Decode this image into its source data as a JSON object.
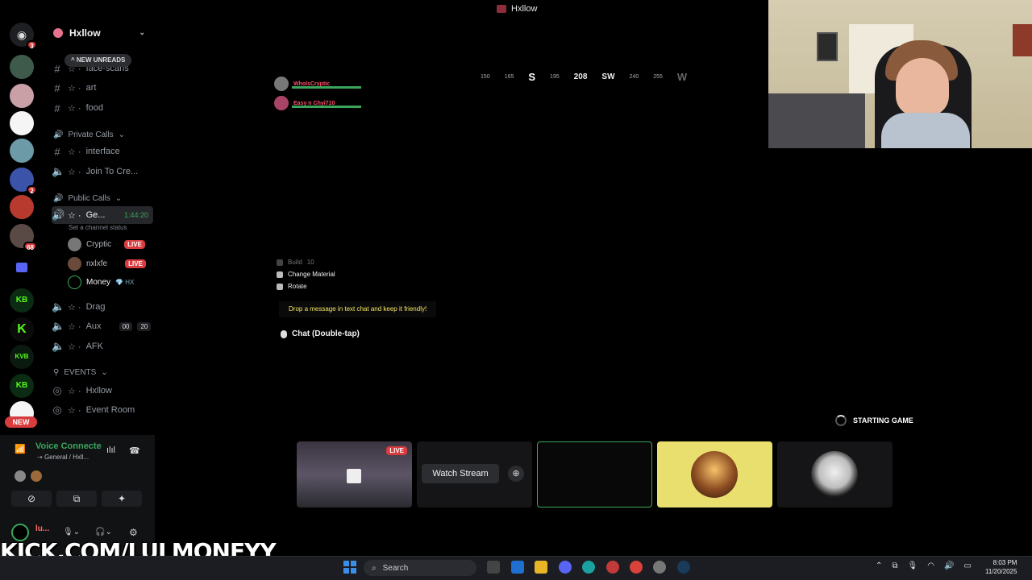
{
  "window": {
    "title": "Hxllow"
  },
  "rail": {
    "servers": [
      {
        "icon": "discord-home-icon",
        "badge": "3"
      },
      {
        "icon": "server-avatar-icon",
        "badge": ""
      },
      {
        "icon": "server-hxllow-icon",
        "badge": ""
      },
      {
        "icon": "server-money-icon",
        "badge": ""
      },
      {
        "icon": "server-landscape-icon",
        "badge": ""
      },
      {
        "icon": "server-blue-icon",
        "badge": "2"
      },
      {
        "icon": "server-red-icon",
        "badge": ""
      },
      {
        "icon": "server-group-icon",
        "badge": "68"
      },
      {
        "icon": "folder-icon",
        "badge": ""
      },
      {
        "icon": "server-kb-icon",
        "badge": ""
      },
      {
        "icon": "server-kick-icon",
        "badge": ""
      },
      {
        "icon": "server-kvb-icon",
        "badge": ""
      },
      {
        "icon": "server-kb2-icon",
        "badge": ""
      },
      {
        "icon": "server-white-icon",
        "badge": ""
      }
    ],
    "new_label": "NEW"
  },
  "guild": {
    "name": "Hxllow",
    "new_unreads": "NEW UNREADS",
    "channels_top": [
      {
        "name": "face-scans",
        "type": "text"
      },
      {
        "name": "art",
        "type": "text"
      },
      {
        "name": "food",
        "type": "text"
      }
    ],
    "cat_private": "Private Calls",
    "private": [
      {
        "name": "interface",
        "type": "text"
      },
      {
        "name": "Join To Cre...",
        "type": "voice"
      }
    ],
    "cat_public": "Public Calls",
    "active_channel": {
      "name": "Ge...",
      "timer": "1:44:20",
      "status": "Set a channel status"
    },
    "voice_users": [
      {
        "name": "Cryptic",
        "live": "LIVE"
      },
      {
        "name": "nxlxfe",
        "live": "LIVE"
      },
      {
        "name": "Money",
        "live": ""
      }
    ],
    "channels_public": [
      {
        "name": "Drag"
      },
      {
        "name": "Aux",
        "count_a": "00",
        "count_b": "20"
      },
      {
        "name": "AFK"
      }
    ],
    "cat_events": "EVENTS",
    "events": [
      {
        "name": "Hxllow"
      },
      {
        "name": "Event Room"
      }
    ]
  },
  "voice_panel": {
    "title": "Voice Connecte",
    "subtitle": "General / Hxll..."
  },
  "user": {
    "name": "lu..."
  },
  "overlay": {
    "kick": "KICK.COM/LULMONEYY"
  },
  "game": {
    "compass": [
      "150",
      "165",
      "S",
      "195",
      "208",
      "SW",
      "240",
      "255",
      "W"
    ],
    "players": [
      {
        "name": "WholsCryptic"
      },
      {
        "name": "Easy n Chyi710"
      }
    ],
    "hints": [
      {
        "label": "Build",
        "extra": "10"
      },
      {
        "label": "Change Material"
      },
      {
        "label": "Rotate"
      }
    ],
    "drop_message": "Drop a message in text chat and keep it friendly!",
    "chat_hint": "Chat (Double-tap)",
    "starting": "STARTING GAME"
  },
  "tiles": {
    "live": "LIVE",
    "watch_stream": "Watch Stream"
  },
  "taskbar": {
    "search": "Search",
    "time": "8:03 PM",
    "date": "11/20/2025"
  },
  "colors": {
    "live": "#d83c3e",
    "voice_green": "#3ba55c",
    "accent": "#5865f2"
  }
}
